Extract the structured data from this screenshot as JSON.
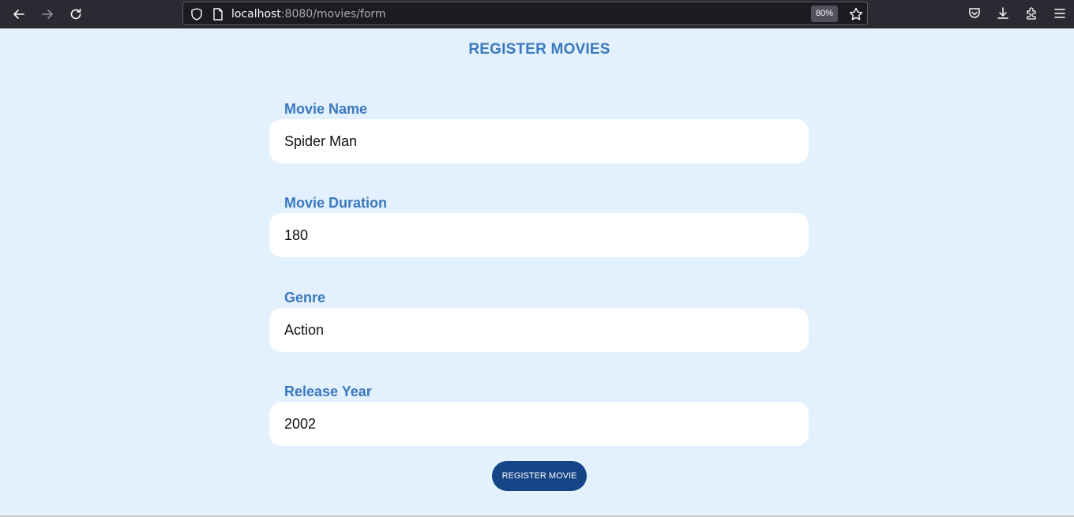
{
  "browser": {
    "url_host": "localhost",
    "url_rest": ":8080/movies/form",
    "zoom": "80%",
    "icons": {
      "back": "arrow-left-icon",
      "forward": "arrow-right-icon",
      "reload": "reload-icon",
      "shield": "shield-icon",
      "page": "page-icon",
      "star": "star-icon",
      "pocket": "pocket-icon",
      "downloads": "download-icon",
      "extensions": "extensions-icon",
      "menu": "hamburger-menu-icon"
    }
  },
  "page": {
    "title": "REGISTER MOVIES",
    "fields": [
      {
        "label": "Movie Name",
        "value": "Spider Man"
      },
      {
        "label": "Movie Duration",
        "value": "180"
      },
      {
        "label": "Genre",
        "value": "Action"
      },
      {
        "label": "Release Year",
        "value": "2002"
      }
    ],
    "submit_label": "REGISTER MOVIE"
  },
  "colors": {
    "page_bg": "#e3f0fd",
    "accent": "#3a78bf",
    "button_bg": "#154586",
    "toolbar_bg": "#2b2a33"
  }
}
